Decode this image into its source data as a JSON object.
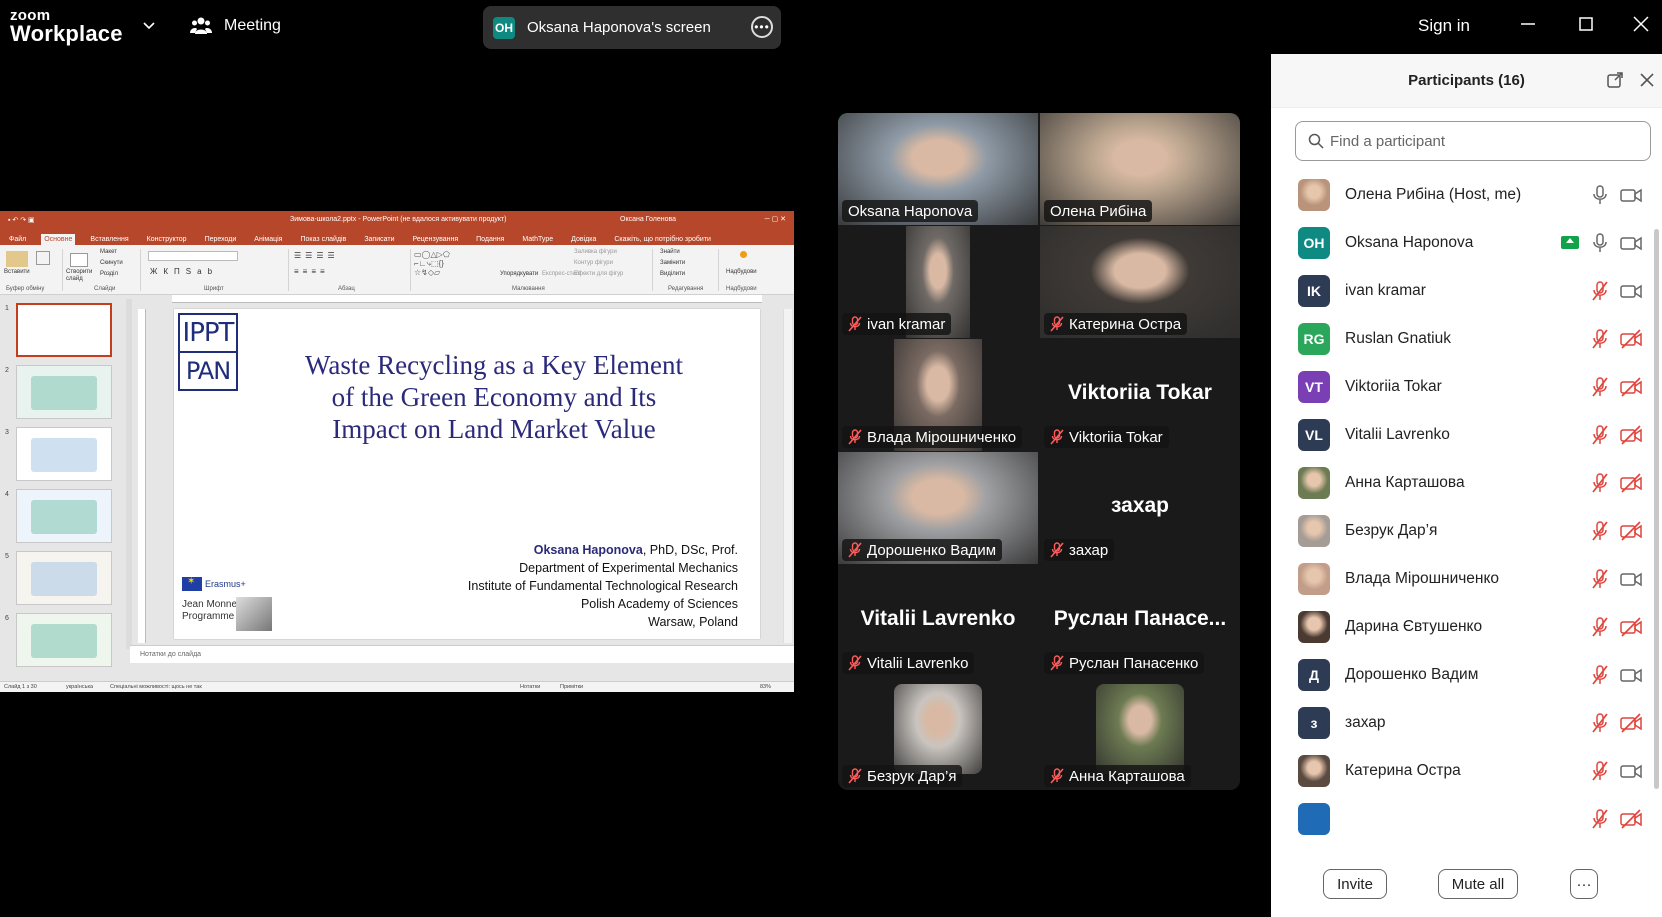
{
  "topbar": {
    "logo_line1": "zoom",
    "logo_line2": "Workplace",
    "meeting_label": "Meeting",
    "screen_share_initials": "OH",
    "screen_share_label": "Oksana Haponova's screen",
    "more_glyph": "•••",
    "sign_in": "Sign in"
  },
  "ppt": {
    "titlebar_center": "Зимова-школа2.pptx - PowerPoint (не вдалося активувати продукт)",
    "titlebar_user": "Оксана Голенова",
    "tabs": [
      "Файл",
      "Основне",
      "Вставлення",
      "Конструктор",
      "Переходи",
      "Анімація",
      "Показ слайдів",
      "Записати",
      "Рецензування",
      "Подання",
      "MathType",
      "Довідка",
      "Скажіть, що потрібно зробити"
    ],
    "ribbon": {
      "paste": "Вставити",
      "layout": "Макет",
      "reset": "Скинути",
      "section": "Розділ",
      "new_slide": "Створити слайд",
      "arrange": "Упорядкувати",
      "quick_styles": "Експрес-стилі",
      "shape_fill": "Заливка фігури",
      "shape_outline": "Контур фігури",
      "shape_effects": "Ефекти для фігур",
      "find": "Знайти",
      "replace": "Замінити",
      "select": "Виділити",
      "addins": "Надбудови",
      "grp_clipboard": "Буфер обміну",
      "grp_slides": "Слайди",
      "grp_font": "Шрифт",
      "grp_paragraph": "Абзац",
      "grp_drawing": "Малювання",
      "grp_editing": "Редагування",
      "grp_addins": "Надбудови"
    },
    "thumb_numbers": [
      "1",
      "2",
      "3",
      "4",
      "5",
      "6"
    ],
    "slide": {
      "logo_top": "IPPT",
      "logo_bottom": "PAN",
      "title": "Waste Recycling as a Key Element of the Green Economy and Its Impact on Land Market Value",
      "author_name": "Oksana Haponova",
      "author_suffix": ", PhD, DSc, Prof.",
      "line2": "Department of Experimental Mechanics",
      "line3": "Institute of Fundamental Technological Research",
      "line4": "Polish Academy of Sciences",
      "line5": "Warsaw, Poland",
      "erasmus": "Erasmus+",
      "jean_monnet_1": "Jean Monnet",
      "jean_monnet_2": "Programme"
    },
    "notes_placeholder": "Нотатки до слайда",
    "status": {
      "slide_count": "Слайд 1 з 30",
      "language": "українська",
      "accessibility": "Спеціальні можливості: щось не так",
      "notes": "Нотатки",
      "comments": "Примітки",
      "zoom": "83%"
    }
  },
  "video_tiles": [
    {
      "name": "Oksana Haponova",
      "muted": false,
      "active": true,
      "photo": true,
      "tone": "#8e9aa6"
    },
    {
      "name": "Олена Рибіна",
      "muted": false,
      "active": false,
      "photo": true,
      "tone": "#b9a48e"
    },
    {
      "name": "ivan kramar",
      "muted": true,
      "active": false,
      "photo": true,
      "tone": "#6f6a66"
    },
    {
      "name": "Катерина Остра",
      "muted": true,
      "active": false,
      "photo": true,
      "tone": "#3f3a36"
    },
    {
      "name": "Влада Мірошниченко",
      "muted": true,
      "active": false,
      "photo": true,
      "tone": "#7a6a62"
    },
    {
      "name": "Viktoriia Tokar",
      "muted": true,
      "active": false,
      "photo": false,
      "big": "Viktoriia Tokar"
    },
    {
      "name": "Дорошенко Вадим",
      "muted": true,
      "active": false,
      "photo": true,
      "tone": "#9fa0a3"
    },
    {
      "name": "захар",
      "muted": true,
      "active": false,
      "photo": false,
      "big": "захар"
    },
    {
      "name": "Vitalii Lavrenko",
      "muted": true,
      "active": false,
      "photo": false,
      "big": "Vitalii Lavrenko"
    },
    {
      "name": "Руслан Панасенко",
      "muted": true,
      "active": false,
      "photo": false,
      "big": "Руслан  Панасе..."
    },
    {
      "name": "Безрук Дар’я",
      "muted": true,
      "active": false,
      "photo": true,
      "tone": "#c9c4bf"
    },
    {
      "name": "Анна Карташова",
      "muted": true,
      "active": false,
      "photo": true,
      "tone": "#6d7b52"
    }
  ],
  "participants": {
    "title": "Participants (16)",
    "search_placeholder": "Find a participant",
    "items": [
      {
        "name": "Олена Рибіна (Host, me)",
        "initials": "",
        "color": "#b9937a",
        "photo": true,
        "mic_muted": false,
        "cam_off": false,
        "sharing": false
      },
      {
        "name": "Oksana Haponova",
        "initials": "OH",
        "color": "#0e8a82",
        "photo": false,
        "mic_muted": false,
        "cam_off": false,
        "sharing": true
      },
      {
        "name": " ivan kramar",
        "initials": "IK",
        "color": "#2e3b55",
        "photo": false,
        "mic_muted": true,
        "cam_off": false,
        "sharing": false
      },
      {
        "name": "Ruslan Gnatiuk",
        "initials": "RG",
        "color": "#2aa75a",
        "photo": false,
        "mic_muted": true,
        "cam_off": true,
        "sharing": false
      },
      {
        "name": "Viktoriia Tokar",
        "initials": "VT",
        "color": "#7b3fb5",
        "photo": false,
        "mic_muted": true,
        "cam_off": true,
        "sharing": false
      },
      {
        "name": "Vitalii Lavrenko",
        "initials": "VL",
        "color": "#2e3b55",
        "photo": false,
        "mic_muted": true,
        "cam_off": true,
        "sharing": false
      },
      {
        "name": "Анна Карташова",
        "initials": "",
        "color": "#6d7b52",
        "photo": true,
        "mic_muted": true,
        "cam_off": true,
        "sharing": false
      },
      {
        "name": "Безрук Дар’я",
        "initials": "",
        "color": "#a59c95",
        "photo": true,
        "mic_muted": true,
        "cam_off": true,
        "sharing": false
      },
      {
        "name": "Влада Мірошниченко",
        "initials": "",
        "color": "#c29e8a",
        "photo": true,
        "mic_muted": true,
        "cam_off": false,
        "sharing": false
      },
      {
        "name": "Дарина Євтушенко",
        "initials": "",
        "color": "#4a3a32",
        "photo": true,
        "mic_muted": true,
        "cam_off": true,
        "sharing": false
      },
      {
        "name": "Дорошенко Вадим",
        "initials": "Д",
        "color": "#2e3b55",
        "photo": false,
        "mic_muted": true,
        "cam_off": false,
        "sharing": false
      },
      {
        "name": "захар",
        "initials": "з",
        "color": "#2e3b55",
        "photo": false,
        "mic_muted": true,
        "cam_off": true,
        "sharing": false
      },
      {
        "name": "Катерина Остра",
        "initials": "",
        "color": "#5b4a40",
        "photo": true,
        "mic_muted": true,
        "cam_off": false,
        "sharing": false
      },
      {
        "name": "",
        "initials": "",
        "color": "#1f6bb5",
        "photo": false,
        "mic_muted": true,
        "cam_off": true,
        "sharing": false
      }
    ],
    "footer": {
      "invite": "Invite",
      "mute_all": "Mute all",
      "more": "···"
    }
  }
}
